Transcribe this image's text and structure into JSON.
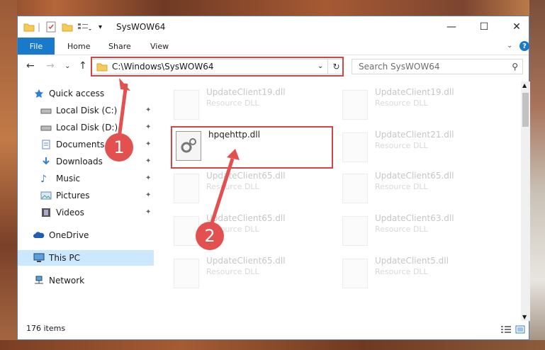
{
  "window": {
    "title": "SysWOW64"
  },
  "ribbon": {
    "tabs": [
      "File",
      "Home",
      "Share",
      "View"
    ]
  },
  "address": {
    "path": "C:\\Windows\\SysWOW64",
    "search_placeholder": "Search SysWOW64"
  },
  "sidebar": {
    "items": [
      {
        "label": "Quick access"
      },
      {
        "label": "Local Disk (C:)"
      },
      {
        "label": "Local Disk (D:)"
      },
      {
        "label": "Documents"
      },
      {
        "label": "Downloads"
      },
      {
        "label": "Music"
      },
      {
        "label": "Pictures"
      },
      {
        "label": "Videos"
      },
      {
        "label": "OneDrive"
      },
      {
        "label": "This PC"
      },
      {
        "label": "Network"
      }
    ]
  },
  "files": {
    "left": [
      {
        "name": "UpdateClient19.dll",
        "type": "Resource DLL"
      },
      {
        "name": "UpdateClient65.dll",
        "type": "Resource DLL"
      },
      {
        "name": "UpdateClient65.dll",
        "type": "Resource DLL"
      },
      {
        "name": "UpdateClient65.dll",
        "type": "Resource DLL"
      }
    ],
    "right": [
      {
        "name": "UpdateClient19.dll",
        "type": "Resource DLL"
      },
      {
        "name": "UpdateClient21.dll",
        "type": "Resource DLL"
      },
      {
        "name": "UpdateClient65.dll",
        "type": "Resource DLL"
      },
      {
        "name": "UpdateClient63.dll",
        "type": "Resource DLL"
      },
      {
        "name": "UpdateClient5.dll",
        "type": "Resource DLL"
      }
    ],
    "highlighted": {
      "name": "hpqehttp.dll"
    }
  },
  "status": {
    "item_count": "176 items"
  },
  "annotations": {
    "step1": "1",
    "step2": "2"
  },
  "colors": {
    "accent": "#1979ca",
    "highlight": "#d04545",
    "selected": "#cce8ff"
  }
}
